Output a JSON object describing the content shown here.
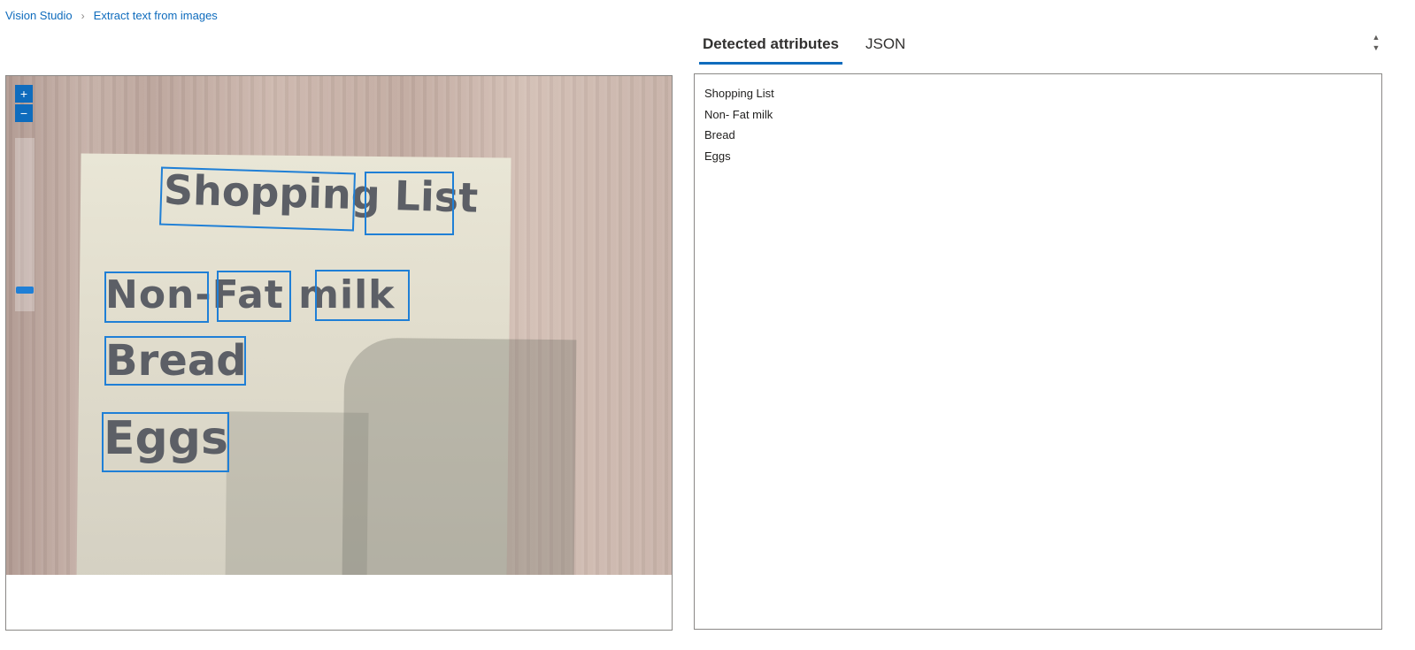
{
  "breadcrumb": {
    "items": [
      "Vision Studio",
      "Extract text from images"
    ],
    "separator": "›"
  },
  "viewer": {
    "zoom_in_label": "+",
    "zoom_out_label": "−",
    "zoom_level_fraction": 0.15,
    "handwriting": {
      "title": "Shopping List",
      "line1": "Non-Fat milk",
      "line2": "Bread",
      "line3": "Eggs"
    },
    "bbox_color": "#1f7fd6"
  },
  "tabs": [
    {
      "label": "Detected attributes",
      "active": true
    },
    {
      "label": "JSON",
      "active": false
    }
  ],
  "results": {
    "lines": [
      "Shopping List",
      "Non- Fat milk",
      "Bread",
      "Eggs"
    ]
  },
  "colors": {
    "accent": "#0f6cbd"
  }
}
